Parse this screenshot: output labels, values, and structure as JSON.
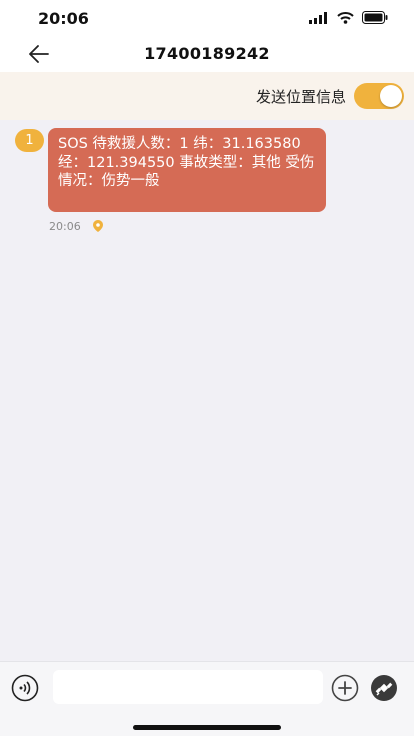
{
  "status_bar": {
    "time": "20:06",
    "icons": [
      "signal-icon",
      "wifi-icon",
      "battery-icon"
    ]
  },
  "nav": {
    "title": "17400189242",
    "back_icon": "arrow-left-icon"
  },
  "location_bar": {
    "label": "发送位置信息",
    "toggle_on": true
  },
  "messages": [
    {
      "badge": "1",
      "text": "SOS 待救援人数：1 纬：31.163580 经：121.394550 事故类型：其他 受伤情况：伤势一般",
      "time": "20:06",
      "location_icon": "location-pin-icon"
    }
  ],
  "input_bar": {
    "value": "",
    "placeholder": "",
    "voice_icon": "voice-icon",
    "add_icon": "add-circle-icon",
    "satellite_icon": "satellite-icon"
  },
  "colors": {
    "accent": "#f0b23d",
    "bubble": "#d56b55",
    "background": "#f1f0f5",
    "location_bar": "#f9f3ec"
  }
}
